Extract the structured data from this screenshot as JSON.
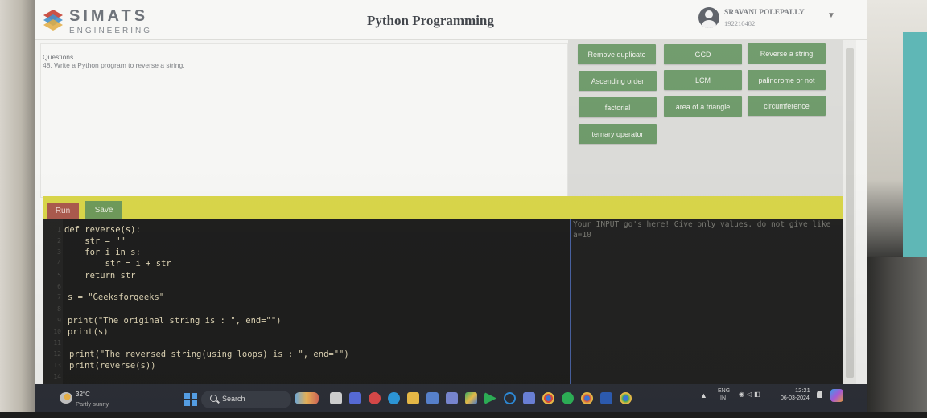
{
  "header": {
    "brand_name": "SIMATS",
    "brand_sub": "ENGINEERING",
    "app_title": "Python Programming",
    "user_name": "SRAVANI POLEPALLY",
    "user_id": "192210482"
  },
  "question": {
    "heading": "Questions",
    "text": "48. Write a Python program to reverse a string."
  },
  "programs": [
    {
      "label": "Remove duplicate"
    },
    {
      "label": "GCD"
    },
    {
      "label": "Reverse a string"
    },
    {
      "label": "Ascending order"
    },
    {
      "label": "LCM"
    },
    {
      "label": "palindrome or not"
    },
    {
      "label": "factorial"
    },
    {
      "label": "area of a triangle"
    },
    {
      "label": "circumference"
    },
    {
      "label": "ternary operator"
    }
  ],
  "toolbar": {
    "run_label": "Run",
    "save_label": "Save"
  },
  "editor": {
    "lines": [
      {
        "n": "1",
        "code": "def reverse(s):"
      },
      {
        "n": "2",
        "code": "    str = \"\""
      },
      {
        "n": "3",
        "code": "    for i in s:"
      },
      {
        "n": "4",
        "code": "        str = i + str"
      },
      {
        "n": "5",
        "code": "    return str"
      },
      {
        "n": "6",
        "code": ""
      },
      {
        "n": "7",
        "code": "s = \"Geeksforgeeks\""
      },
      {
        "n": "8",
        "code": ""
      },
      {
        "n": "9",
        "code": "print(\"The original string is : \", end=\"\")"
      },
      {
        "n": "10",
        "code": "print(s)"
      },
      {
        "n": "11",
        "code": ""
      },
      {
        "n": "12",
        "code": "print(\"The reversed string(using loops) is : \", end=\"\")"
      },
      {
        "n": "13",
        "code": "print(reverse(s))"
      },
      {
        "n": "14",
        "code": ""
      }
    ]
  },
  "input_panel": {
    "placeholder": "Your INPUT go's here! Give only values. do not give like a=10"
  },
  "taskbar": {
    "temperature": "32°C",
    "weather": "Partly sunny",
    "search_label": "Search",
    "lang_1": "ENG",
    "lang_2": "IN",
    "time": "12:21",
    "date": "06-03-2024"
  }
}
